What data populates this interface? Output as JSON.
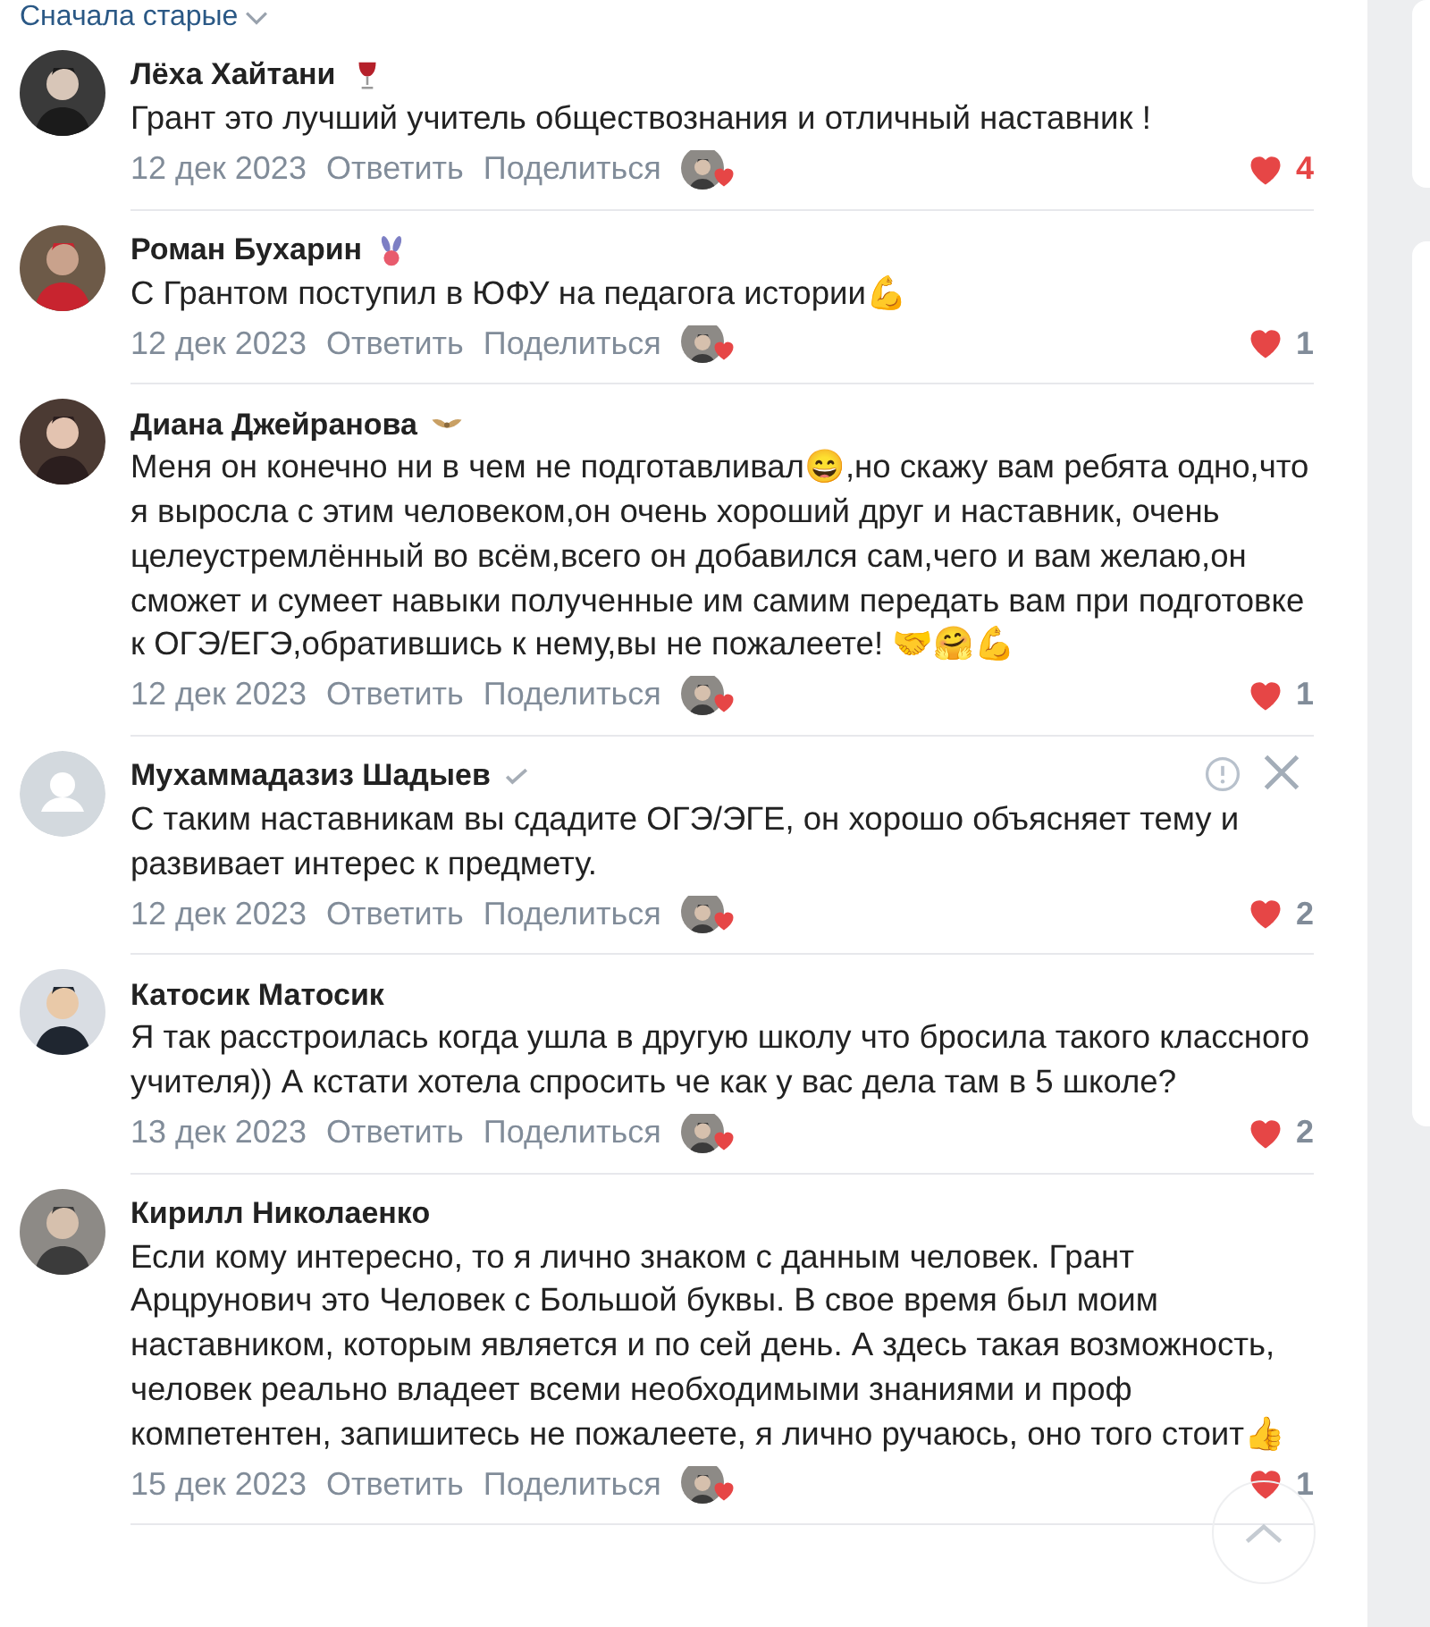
{
  "sort": {
    "label": "Сначала старые"
  },
  "comments": [
    {
      "author": "Лёха Хайтани",
      "badge": {
        "kind": "wine"
      },
      "hovered": false,
      "text": "Грант это лучший учитель обществознания и отличный наставник !",
      "date": "12 дек 2023",
      "reply": "Ответить",
      "share": "Поделиться",
      "likes": "4",
      "liked": true
    },
    {
      "author": "Роман Бухарин",
      "badge": {
        "kind": "bunny"
      },
      "hovered": false,
      "text": "С Грантом поступил в ЮФУ на педагога истории💪",
      "date": "12 дек 2023",
      "reply": "Ответить",
      "share": "Поделиться",
      "likes": "1",
      "liked": false
    },
    {
      "author": "Диана Джейранова",
      "badge": {
        "kind": "wings"
      },
      "hovered": false,
      "text": "Меня он конечно ни в чем не подготавливал😄,но скажу вам ребята одно,что я выросла с этим человеком,он очень хороший друг и наставник, очень целеустремлённый во всём,всего он добавился сам,чего и вам желаю,он сможет и сумеет навыки полученные им самим передать вам при подготовке к ОГЭ/ЕГЭ,обратившись к нему,вы не пожалеете! 🤝🤗💪",
      "date": "12 дек 2023",
      "reply": "Ответить",
      "share": "Поделиться",
      "likes": "1",
      "liked": false
    },
    {
      "author": "Мухаммадазиз Шадыев",
      "badge": {
        "kind": "verified"
      },
      "avatar": {
        "kind": "default"
      },
      "hovered": true,
      "text": "С таким наставникам вы сдадите ОГЭ/ЭГЕ, он хорошо объясняет тему и развивает интерес к предмету.",
      "date": "12 дек 2023",
      "reply": "Ответить",
      "share": "Поделиться",
      "likes": "2",
      "liked": false
    },
    {
      "author": "Катосик Матосик",
      "hovered": false,
      "text": "Я так расстроилась когда ушла в другую школу что бросила такого классного учителя)) А кстати хотела спросить че как у вас дела там в 5 школе?",
      "date": "13 дек 2023",
      "reply": "Ответить",
      "share": "Поделиться",
      "likes": "2",
      "liked": false
    },
    {
      "author": "Кирилл Николаенко",
      "hovered": false,
      "text": "Если кому интересно, то я лично знаком с данным человек. Грант Арцрунович это Человек с Большой буквы. В свое время был моим наставником, которым является и по сей день. А здесь такая возможность, человек реально владеет всеми необходимыми знаниями и проф компетентен, запишитесь не пожалеете, я лично ручаюсь, оно того стоит👍",
      "date": "15 дек 2023",
      "reply": "Ответить",
      "share": "Поделиться",
      "likes": "1",
      "liked": false
    }
  ]
}
